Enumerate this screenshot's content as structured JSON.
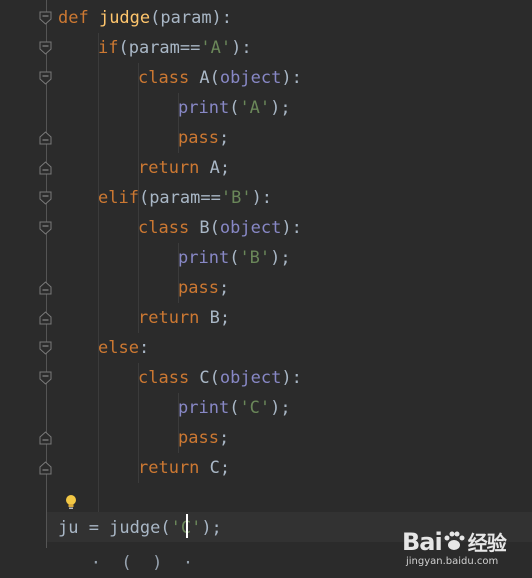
{
  "editor": {
    "lines": [
      {
        "indent": 0,
        "tokens": [
          {
            "t": "kw",
            "v": "def "
          },
          {
            "t": "fn",
            "v": "judge"
          },
          {
            "t": "op",
            "v": "(param):"
          }
        ]
      },
      {
        "indent": 1,
        "tokens": [
          {
            "t": "kw",
            "v": "if"
          },
          {
            "t": "op",
            "v": "(param=="
          },
          {
            "t": "str",
            "v": "'A'"
          },
          {
            "t": "op",
            "v": "):"
          }
        ]
      },
      {
        "indent": 2,
        "tokens": [
          {
            "t": "kw",
            "v": "class "
          },
          {
            "t": "id",
            "v": "A("
          },
          {
            "t": "bi",
            "v": "object"
          },
          {
            "t": "op",
            "v": "):"
          }
        ]
      },
      {
        "indent": 3,
        "tokens": [
          {
            "t": "bi",
            "v": "print"
          },
          {
            "t": "op",
            "v": "("
          },
          {
            "t": "str",
            "v": "'A'"
          },
          {
            "t": "op",
            "v": ");"
          }
        ]
      },
      {
        "indent": 3,
        "tokens": [
          {
            "t": "kw",
            "v": "pass"
          },
          {
            "t": "op",
            "v": ";"
          }
        ]
      },
      {
        "indent": 2,
        "tokens": [
          {
            "t": "kw",
            "v": "return "
          },
          {
            "t": "id",
            "v": "A;"
          }
        ]
      },
      {
        "indent": 1,
        "tokens": [
          {
            "t": "kw",
            "v": "elif"
          },
          {
            "t": "op",
            "v": "(param=="
          },
          {
            "t": "str",
            "v": "'B'"
          },
          {
            "t": "op",
            "v": "):"
          }
        ]
      },
      {
        "indent": 2,
        "tokens": [
          {
            "t": "kw",
            "v": "class "
          },
          {
            "t": "id",
            "v": "B("
          },
          {
            "t": "bi",
            "v": "object"
          },
          {
            "t": "op",
            "v": "):"
          }
        ]
      },
      {
        "indent": 3,
        "tokens": [
          {
            "t": "bi",
            "v": "print"
          },
          {
            "t": "op",
            "v": "("
          },
          {
            "t": "str",
            "v": "'B'"
          },
          {
            "t": "op",
            "v": ");"
          }
        ]
      },
      {
        "indent": 3,
        "tokens": [
          {
            "t": "kw",
            "v": "pass"
          },
          {
            "t": "op",
            "v": ";"
          }
        ]
      },
      {
        "indent": 2,
        "tokens": [
          {
            "t": "kw",
            "v": "return "
          },
          {
            "t": "id",
            "v": "B;"
          }
        ]
      },
      {
        "indent": 1,
        "tokens": [
          {
            "t": "kw",
            "v": "else"
          },
          {
            "t": "op",
            "v": ":"
          }
        ]
      },
      {
        "indent": 2,
        "tokens": [
          {
            "t": "kw",
            "v": "class "
          },
          {
            "t": "id",
            "v": "C("
          },
          {
            "t": "bi",
            "v": "object"
          },
          {
            "t": "op",
            "v": "):"
          }
        ]
      },
      {
        "indent": 3,
        "tokens": [
          {
            "t": "bi",
            "v": "print"
          },
          {
            "t": "op",
            "v": "("
          },
          {
            "t": "str",
            "v": "'C'"
          },
          {
            "t": "op",
            "v": ");"
          }
        ]
      },
      {
        "indent": 3,
        "tokens": [
          {
            "t": "kw",
            "v": "pass"
          },
          {
            "t": "op",
            "v": ";"
          }
        ]
      },
      {
        "indent": 2,
        "tokens": [
          {
            "t": "kw",
            "v": "return "
          },
          {
            "t": "id",
            "v": "C;"
          }
        ]
      },
      {
        "indent": 0,
        "tokens": []
      },
      {
        "indent": 0,
        "tokens": [
          {
            "t": "id",
            "v": "ju = judge("
          },
          {
            "t": "str",
            "v": "'C'"
          },
          {
            "t": "op",
            "v": ");"
          }
        ]
      }
    ],
    "colors": {
      "background": "#2b2b2b",
      "keyword": "#cc7832",
      "function": "#ffc66d",
      "identifier": "#a9b7c6",
      "string": "#6a8759",
      "builtin": "#8888c6"
    },
    "icons": {
      "intention": "lightbulb-icon",
      "fold": "fold-marker-icon"
    }
  },
  "watermark": {
    "logo_text": "Bai",
    "logo_suffix": "经验",
    "url": "jingyan.baidu.com"
  }
}
